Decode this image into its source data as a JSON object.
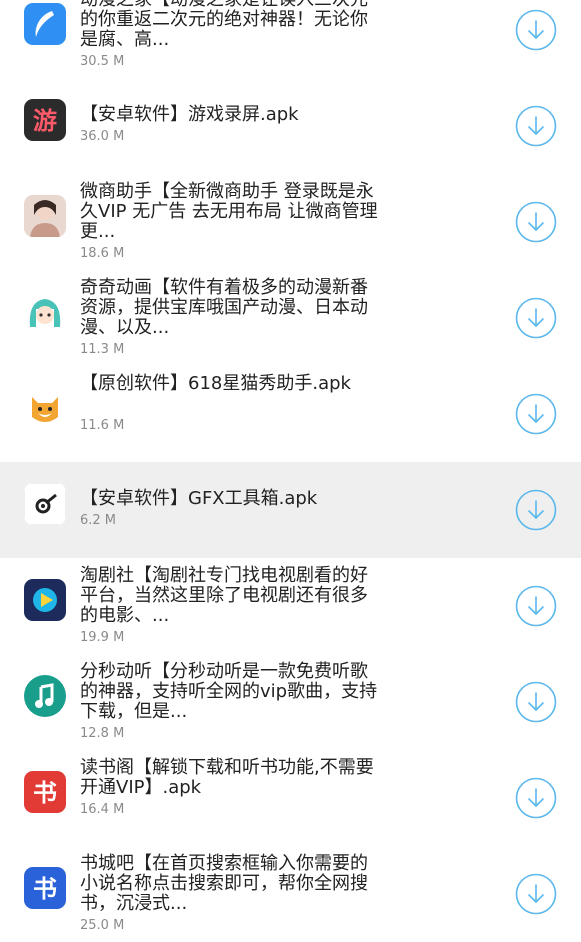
{
  "apps": [
    {
      "title": "动漫之家【动漫之家是让误入三次元的你重返二次元的绝对神器！无论你是腐、高...",
      "size": "30.5 M",
      "icon": "feather-app-icon",
      "color": "#2f8ff2"
    },
    {
      "title": "【安卓软件】游戏录屏.apk",
      "size": "36.0 M",
      "icon": "game-recorder-app-icon",
      "color": "#2b2b2b",
      "glyph": "游"
    },
    {
      "title": "微商助手【全新微商助手 登录既是永久VIP 无广告 去无用布局 让微商管理更...",
      "size": "18.6 M",
      "icon": "user-photo-app-icon",
      "color": "#c79a8a"
    },
    {
      "title": "奇奇动画【软件有着极多的动漫新番资源，提供宝库哦国产动漫、日本动漫、以及...",
      "size": "11.3 M",
      "icon": "anime-girl-app-icon",
      "color": "#49c3b8"
    },
    {
      "title": "【原创软件】618星猫秀助手.apk",
      "size": "11.6 M",
      "icon": "cat-face-app-icon",
      "color": "#f2a531"
    },
    {
      "title": "【安卓软件】GFX工具箱.apk",
      "size": "6.2 M",
      "icon": "gear-tool-app-icon",
      "color": "#ffffff",
      "highlight": true
    },
    {
      "title": "淘剧社【淘剧社专门找电视剧看的好平台，当然这里除了电视剧还有很多的电影、...",
      "size": "19.9 M",
      "icon": "play-button-app-icon",
      "color": "#1c2b5c"
    },
    {
      "title": "分秒动听【分秒动听是一款免费听歌的神器，支持听全网的vip歌曲，支持下载，但是...",
      "size": "12.8 M",
      "icon": "music-note-app-icon",
      "color": "#1a9e8c"
    },
    {
      "title": "读书阁【解锁下载和听书功能,不需要开通VIP】.apk",
      "size": "16.4 M",
      "icon": "book-app-icon",
      "color": "#e23a35",
      "glyph": "书"
    },
    {
      "title": "书城吧【在首页搜索框输入你需要的小说名称点击搜索即可，帮你全网搜书，沉浸式...",
      "size": "25.0 M",
      "icon": "book-city-app-icon",
      "color": "#2a63d9",
      "glyph": "书"
    }
  ],
  "download_icon": "download-arrow-icon",
  "download_color": "#5ab8ec"
}
